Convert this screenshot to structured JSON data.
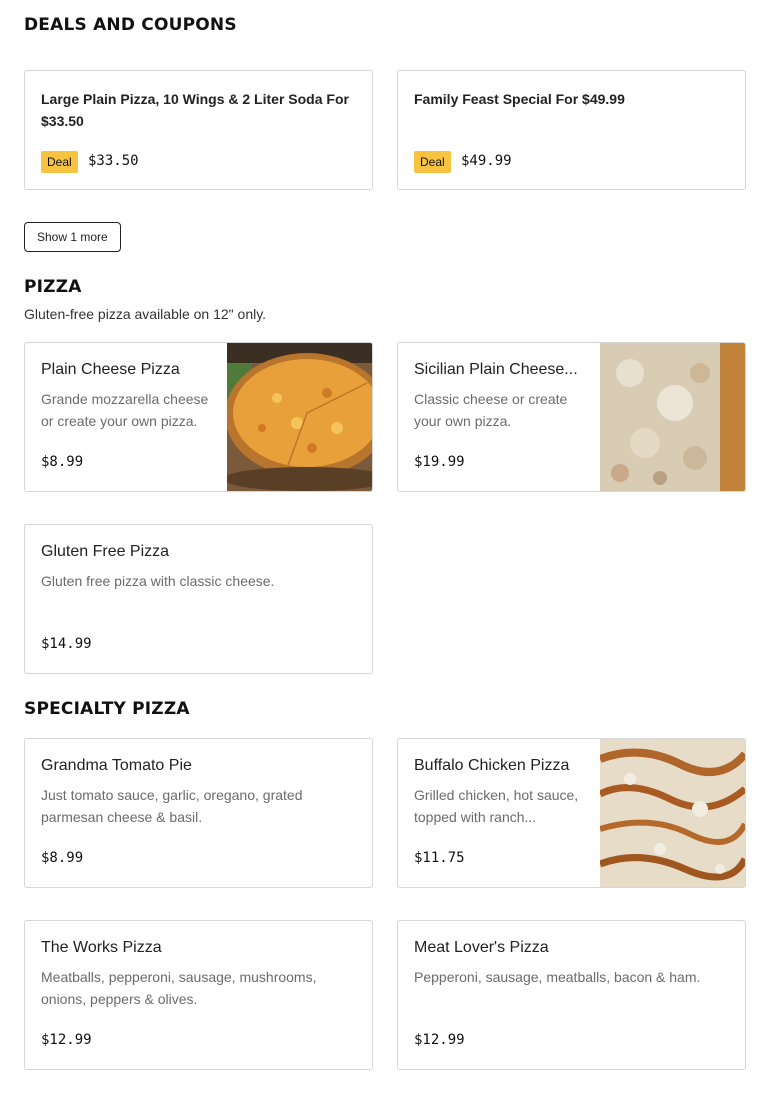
{
  "deals": {
    "title": "DEALS AND COUPONS",
    "items": [
      {
        "name": "Large Plain Pizza, 10 Wings & 2 Liter Soda For $33.50",
        "badge": "Deal",
        "price": "$33.50"
      },
      {
        "name": "Family Feast Special For $49.99",
        "badge": "Deal",
        "price": "$49.99"
      }
    ],
    "show_more_label": "Show 1 more"
  },
  "pizza": {
    "title": "PIZZA",
    "subtitle": "Gluten-free pizza available on 12\" only.",
    "items": [
      {
        "name": "Plain Cheese Pizza",
        "desc": "Grande mozzarella cheese or create your own pizza.",
        "price": "$8.99"
      },
      {
        "name": "Sicilian Plain Cheese...",
        "desc": "Classic cheese or create your own pizza.",
        "price": "$19.99"
      },
      {
        "name": "Gluten Free Pizza",
        "desc": "Gluten free pizza with classic cheese.",
        "price": "$14.99"
      }
    ]
  },
  "specialty": {
    "title": "SPECIALTY PIZZA",
    "items": [
      {
        "name": "Grandma Tomato Pie",
        "desc": "Just tomato sauce, garlic, oregano, grated parmesan cheese & basil.",
        "price": "$8.99"
      },
      {
        "name": "Buffalo Chicken Pizza",
        "desc": "Grilled chicken, hot sauce, topped with ranch...",
        "price": "$11.75"
      },
      {
        "name": "The Works Pizza",
        "desc": "Meatballs, pepperoni, sausage, mushrooms, onions, peppers & olives.",
        "price": "$12.99"
      },
      {
        "name": "Meat Lover's Pizza",
        "desc": "Pepperoni, sausage, meatballs, bacon & ham.",
        "price": "$12.99"
      }
    ]
  },
  "colors": {
    "deal_badge": "#f7c341",
    "border": "#d6d6d6",
    "description": "#6b6b6b"
  }
}
